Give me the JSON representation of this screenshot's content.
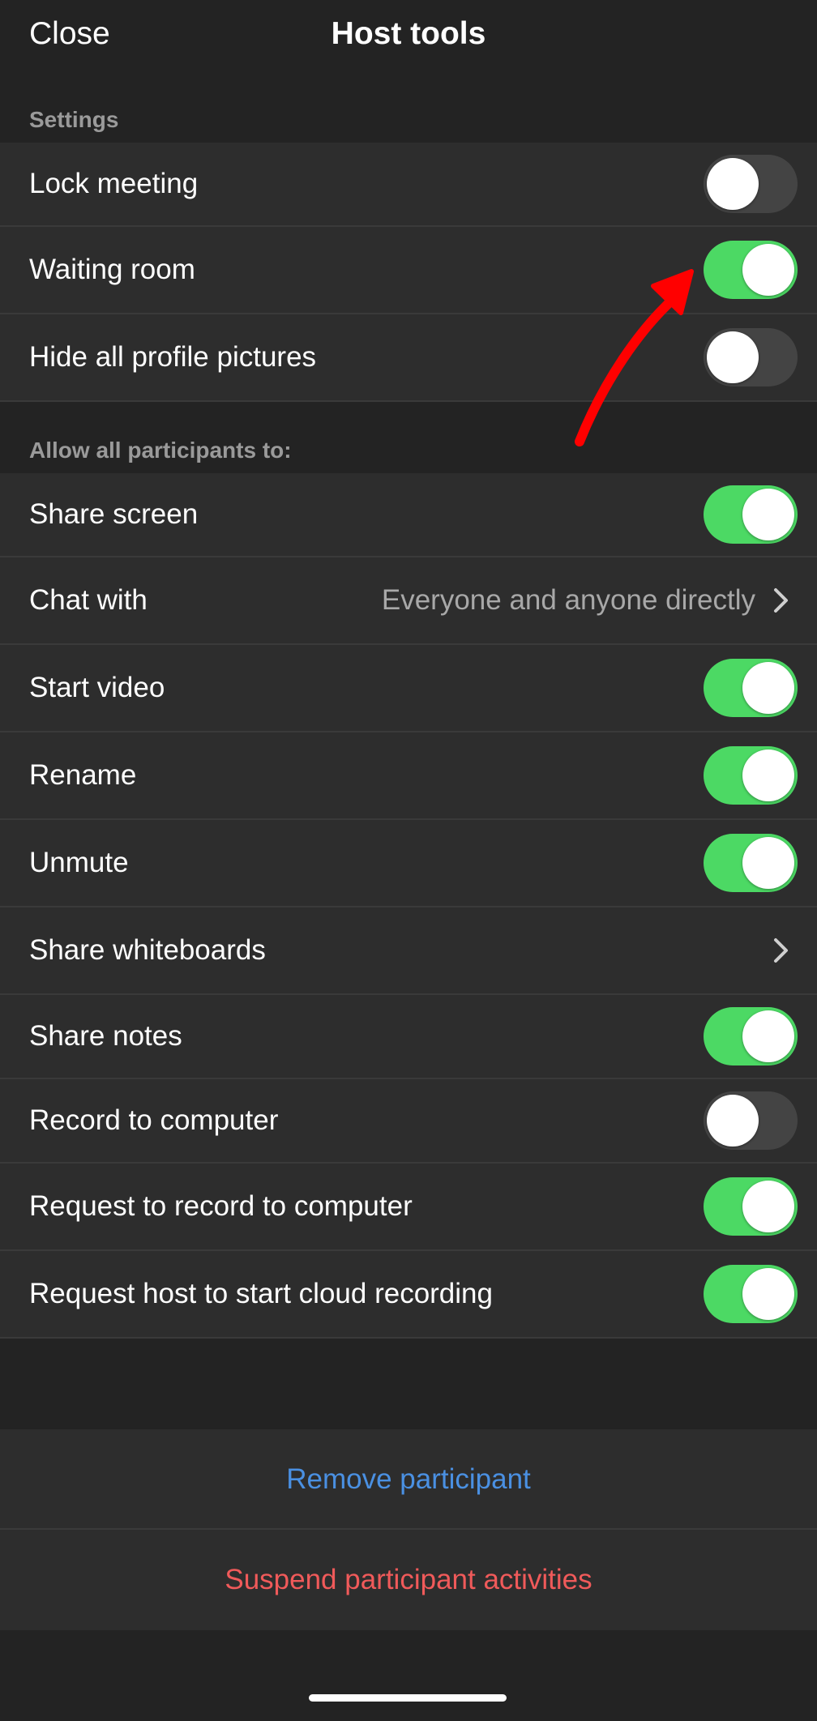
{
  "header": {
    "close_label": "Close",
    "title": "Host tools"
  },
  "settings": {
    "section_label": "Settings",
    "items": [
      {
        "label": "Lock meeting",
        "toggle_on": false
      },
      {
        "label": "Waiting room",
        "toggle_on": true
      },
      {
        "label": "Hide all profile pictures",
        "toggle_on": false
      }
    ]
  },
  "participants": {
    "section_label": "Allow all participants to:",
    "items": [
      {
        "label": "Share screen",
        "type": "toggle",
        "toggle_on": true
      },
      {
        "label": "Chat with",
        "type": "select",
        "value": "Everyone and anyone directly"
      },
      {
        "label": "Start video",
        "type": "toggle",
        "toggle_on": true
      },
      {
        "label": "Rename",
        "type": "toggle",
        "toggle_on": true
      },
      {
        "label": "Unmute",
        "type": "toggle",
        "toggle_on": true
      },
      {
        "label": "Share whiteboards",
        "type": "link"
      },
      {
        "label": "Share notes",
        "type": "toggle",
        "toggle_on": true
      },
      {
        "label": "Record to computer",
        "type": "toggle",
        "toggle_on": false
      },
      {
        "label": "Request to record to computer",
        "type": "toggle",
        "toggle_on": true
      },
      {
        "label": "Request host to start cloud recording",
        "type": "toggle",
        "toggle_on": true
      }
    ]
  },
  "actions": {
    "remove_label": "Remove participant",
    "suspend_label": "Suspend participant activities"
  },
  "colors": {
    "toggle_on": "#4cd964",
    "toggle_off": "#444444",
    "remove": "#4a90e2",
    "suspend": "#f05a5a",
    "annotation_arrow": "#ff0000"
  },
  "icons": {
    "chevron": "chevron-right-icon",
    "annotation": "red-arrow-icon"
  }
}
